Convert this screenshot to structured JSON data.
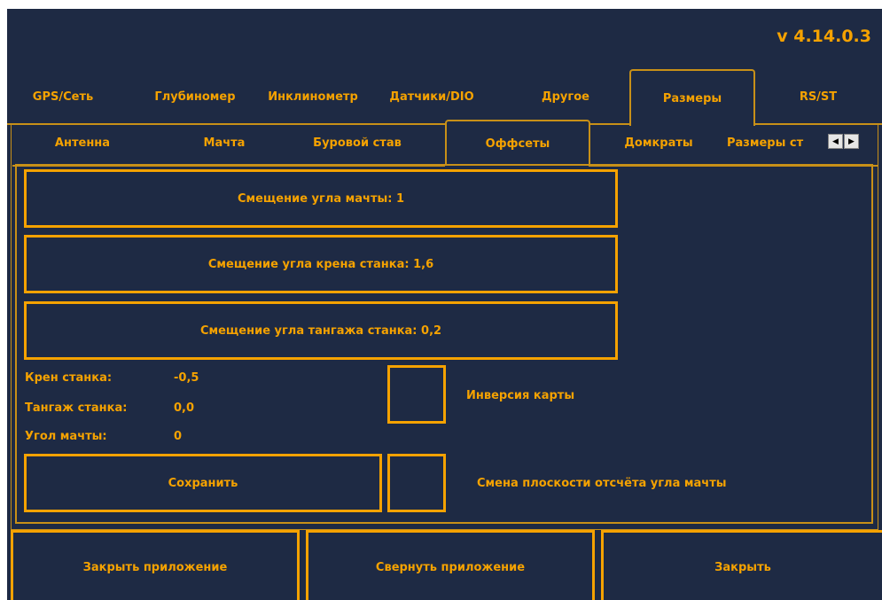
{
  "version": "v 4.14.0.3",
  "main_tabs": [
    "GPS/Сеть",
    "Глубиномер",
    "Инклинометр",
    "Датчики/DIO",
    "Другое",
    "Размеры",
    "RS/ST"
  ],
  "sub_tabs": [
    "Антенна",
    "Мачта",
    "Буровой став",
    "Оффсеты",
    "Домкраты",
    "Размеры ст"
  ],
  "offsets": {
    "mast_angle_btn": "Смещение угла мачты: 1",
    "roll_angle_btn": "Смещение угла крена станка: 1,6",
    "pitch_angle_btn": "Смещение угла тангажа станка: 0,2"
  },
  "readings": {
    "roll_label": "Крен станка:",
    "roll_value": "-0,5",
    "pitch_label": "Тангаж станка:",
    "pitch_value": "0,0",
    "mast_label": "Угол мачты:",
    "mast_value": "0"
  },
  "checkboxes": {
    "map_inversion_label": "Инверсия карты",
    "mast_plane_label": "Смена плоскости отсчёта угла мачты"
  },
  "save_label": "Сохранить",
  "footer": {
    "close_app": "Закрыть приложение",
    "minimize_app": "Свернуть приложение",
    "close": "Закрыть"
  },
  "colors": {
    "background": "#1e2a44",
    "accent": "#f5a200"
  },
  "icons": {
    "scroll_left": "arrow-left-icon",
    "scroll_right": "arrow-right-icon"
  }
}
